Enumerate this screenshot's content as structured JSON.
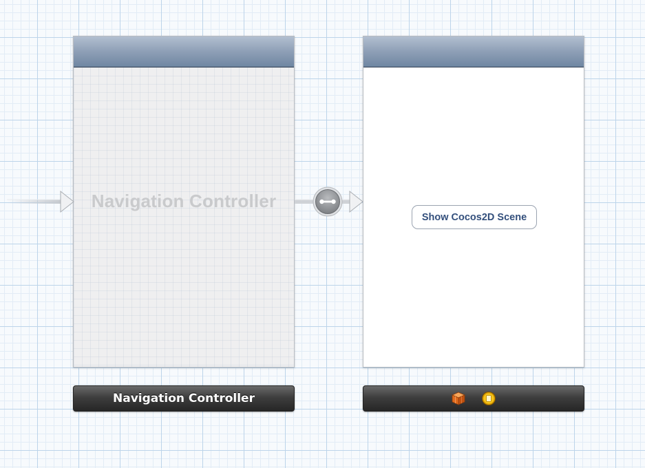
{
  "canvas": {
    "background": "#f7fafd",
    "grid_major_color": "#bcd4ea",
    "grid_minor_color": "#e2ecf6"
  },
  "navigation_controller_scene": {
    "placeholder_title": "Navigation Controller",
    "navbar_color": "#8e9fb6",
    "background": "#efeff0"
  },
  "navigation_controller_dock": {
    "label": "Navigation Controller"
  },
  "root_view_controller_scene": {
    "background": "#ffffff",
    "button_label": "Show Cocos2D Scene",
    "button_text_color": "#334f7c"
  },
  "root_view_controller_dock": {
    "icons": [
      "view-controller-icon",
      "first-responder-icon"
    ]
  },
  "entry_point_arrow": {
    "icon": "initial-view-controller-arrow-icon"
  },
  "segue": {
    "icon": "relationship-segue-icon"
  }
}
